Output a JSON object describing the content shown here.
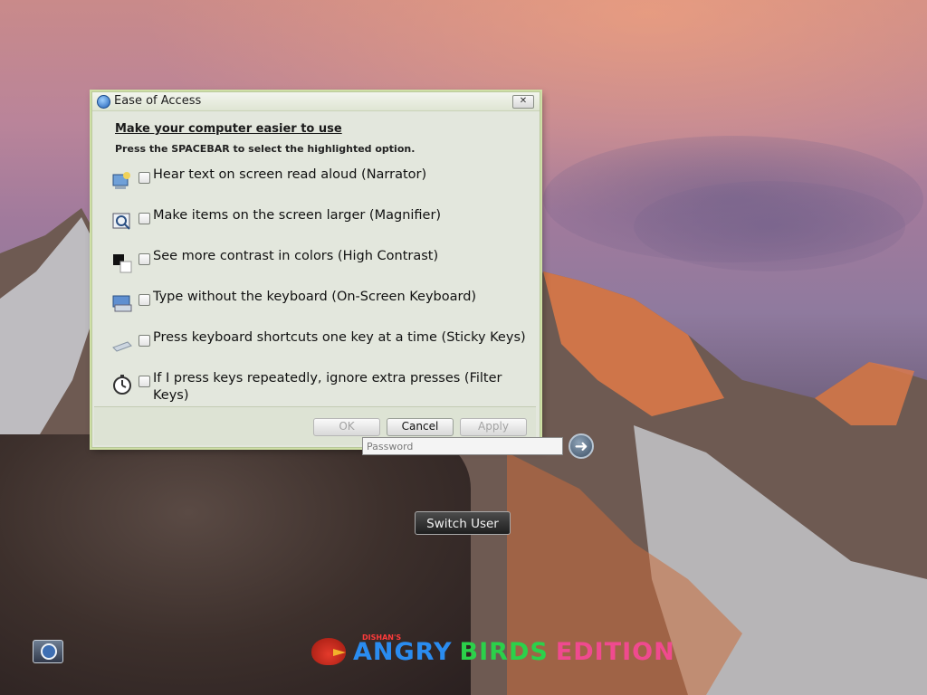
{
  "window": {
    "title": "Ease of Access",
    "close_glyph": "✕",
    "heading": "Make your computer easier to use",
    "instruction": "Press the SPACEBAR to select the highlighted option.",
    "options": [
      {
        "label": "Hear text on screen read aloud (Narrator)",
        "icon": "narrator-icon",
        "checked": false
      },
      {
        "label": "Make items on the screen larger (Magnifier)",
        "icon": "magnifier-icon",
        "checked": false
      },
      {
        "label": "See more contrast in colors (High Contrast)",
        "icon": "high-contrast-icon",
        "checked": false
      },
      {
        "label": "Type without the keyboard (On-Screen Keyboard)",
        "icon": "on-screen-keyboard-icon",
        "checked": false
      },
      {
        "label": "Press keyboard shortcuts one key at a time (Sticky Keys)",
        "icon": "sticky-keys-icon",
        "checked": false
      },
      {
        "label": "If I press keys repeatedly, ignore extra presses (Filter Keys)",
        "icon": "filter-keys-icon",
        "checked": false
      }
    ],
    "buttons": {
      "ok": "OK",
      "cancel": "Cancel",
      "apply": "Apply"
    }
  },
  "login": {
    "password_placeholder": "Password",
    "switch_user": "Switch User"
  },
  "branding": {
    "small_text": "DISHAN'S",
    "word1": "ANGRY",
    "word2": "BIRDS",
    "word3": "EDITION"
  },
  "colors": {
    "accent": "#1f5fb5",
    "dialog_bg": "#e3e7dd",
    "dialog_border": "#cfe0a6"
  }
}
